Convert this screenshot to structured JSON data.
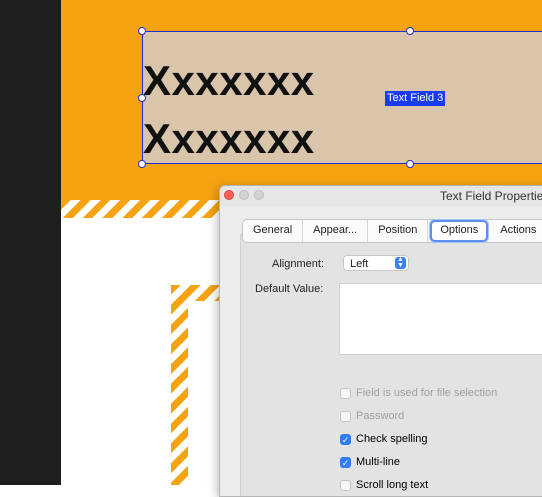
{
  "canvas": {
    "field_lines": [
      "Xxxxxxx",
      "Xxxxxxx"
    ],
    "field_name": "Text Field 3"
  },
  "dialog": {
    "title": "Text Field Properties",
    "tabs": [
      "General",
      "Appear...",
      "Position",
      "Options",
      "Actions"
    ],
    "active_tab": "Options",
    "alignment_label": "Alignment:",
    "alignment_value": "Left",
    "default_value_label": "Default Value:",
    "default_value": "",
    "checkboxes": [
      {
        "label": "Field is used for file selection",
        "checked": false,
        "enabled": false
      },
      {
        "label": "Password",
        "checked": false,
        "enabled": false
      },
      {
        "label": "Check spelling",
        "checked": true,
        "enabled": true
      },
      {
        "label": "Multi-line",
        "checked": true,
        "enabled": true
      },
      {
        "label": "Scroll long text",
        "checked": false,
        "enabled": true
      }
    ]
  },
  "colors": {
    "orange": "#f5a311",
    "field_fill": "#d9c5aa",
    "selection_blue": "#1d2bd6",
    "accent": "#2f7cf6"
  }
}
